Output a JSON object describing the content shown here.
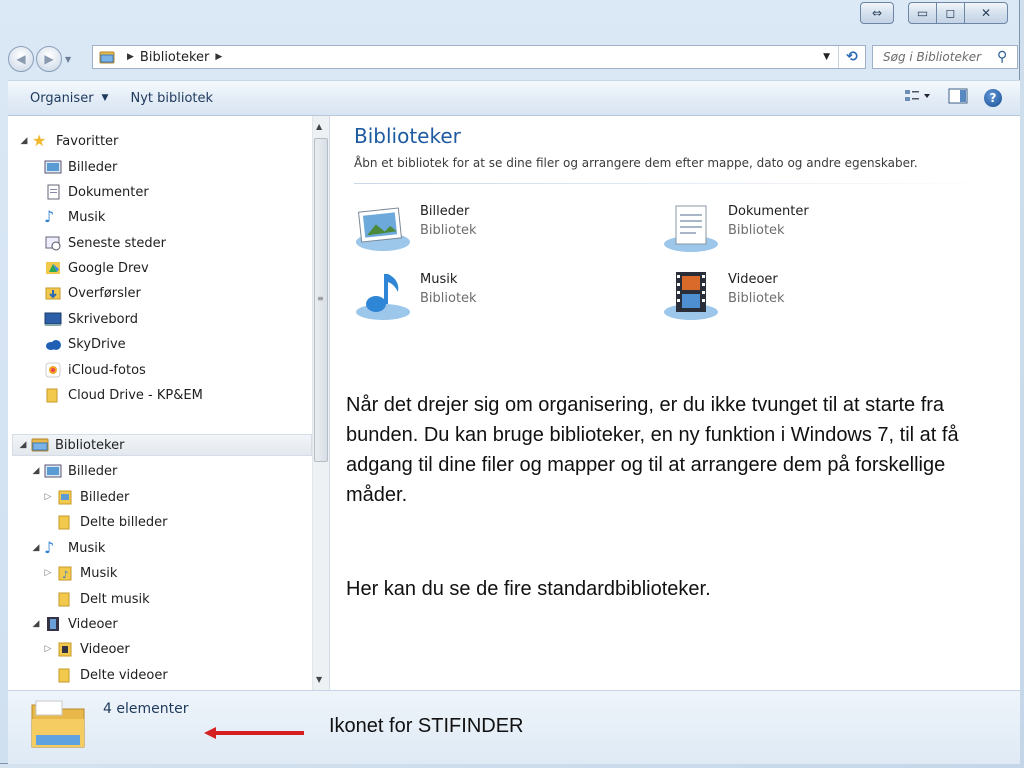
{
  "window": {
    "caption_buttons": {
      "swap": "⇔",
      "minimize": "▭",
      "maximize": "◻",
      "close": "✕"
    }
  },
  "address_bar": {
    "crumbs": [
      "Biblioteker"
    ],
    "search_placeholder": "Søg i Biblioteker"
  },
  "toolbar": {
    "organise_label": "Organiser",
    "new_library_label": "Nyt bibliotek"
  },
  "nav_tree": {
    "favorites_label": "Favoritter",
    "favorites": [
      "Billeder",
      "Dokumenter",
      "Musik",
      "Seneste steder",
      "Google Drev",
      "Overførsler",
      "Skrivebord",
      "SkyDrive",
      "iCloud-fotos",
      "Cloud Drive - KP&EM"
    ],
    "libraries_label": "Biblioteker",
    "libraries": [
      {
        "label": "Billeder",
        "children": [
          "Billeder",
          "Delte billeder"
        ]
      },
      {
        "label": "Musik",
        "children": [
          "Musik",
          "Delt musik"
        ]
      },
      {
        "label": "Videoer",
        "children": [
          "Videoer",
          "Delte videoer"
        ]
      }
    ]
  },
  "content": {
    "title": "Biblioteker",
    "subtitle": "Åbn et bibliotek for at se dine filer og arrangere dem efter mappe, dato og andre egenskaber.",
    "libraries": [
      {
        "name": "Billeder",
        "kind": "Bibliotek",
        "icon": "pictures-library-icon"
      },
      {
        "name": "Dokumenter",
        "kind": "Bibliotek",
        "icon": "documents-library-icon"
      },
      {
        "name": "Musik",
        "kind": "Bibliotek",
        "icon": "music-library-icon"
      },
      {
        "name": "Videoer",
        "kind": "Bibliotek",
        "icon": "videos-library-icon"
      }
    ],
    "paragraph_1": "Når det drejer sig om organisering, er du ikke tvunget til at starte fra bunden. Du kan bruge biblioteker, en ny funktion i Windows 7, til at få adgang til dine filer og mapper og til at arrangere dem på forskellige måder.",
    "paragraph_2": "Her kan du se de fire standardbiblioteker."
  },
  "status_bar": {
    "item_count": "4 elementer",
    "caption": "Ikonet for STIFINDER"
  },
  "colors": {
    "accent_title": "#1e5aa0",
    "arrow_red": "#d42020",
    "window_frame": "#cfe0f1"
  }
}
